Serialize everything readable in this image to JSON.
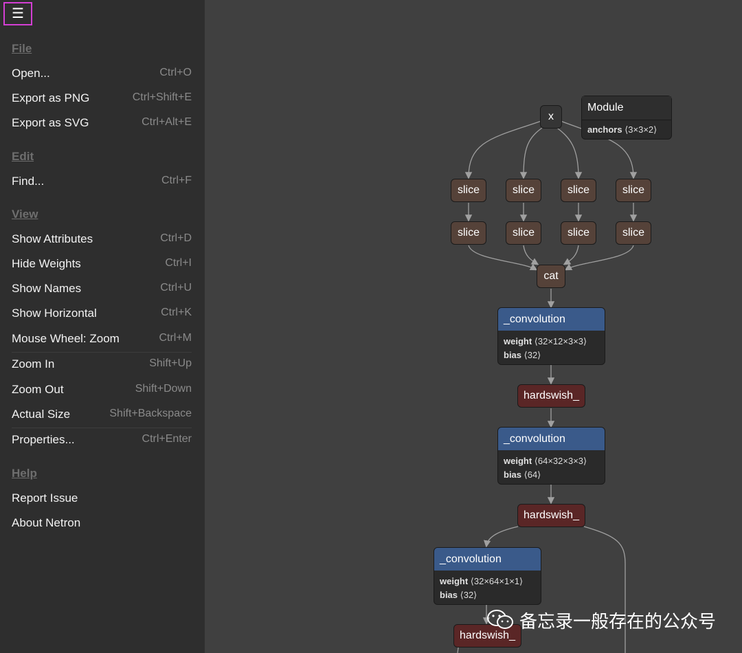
{
  "menu_button": {
    "glyph": "☰"
  },
  "menu": {
    "file": {
      "title": "File",
      "items": [
        {
          "label": "Open...",
          "shortcut": "Ctrl+O"
        },
        {
          "label": "Export as PNG",
          "shortcut": "Ctrl+Shift+E"
        },
        {
          "label": "Export as SVG",
          "shortcut": "Ctrl+Alt+E"
        }
      ]
    },
    "edit": {
      "title": "Edit",
      "items": [
        {
          "label": "Find...",
          "shortcut": "Ctrl+F"
        }
      ]
    },
    "view": {
      "title": "View",
      "items": [
        {
          "label": "Show Attributes",
          "shortcut": "Ctrl+D"
        },
        {
          "label": "Hide Weights",
          "shortcut": "Ctrl+I"
        },
        {
          "label": "Show Names",
          "shortcut": "Ctrl+U"
        },
        {
          "label": "Show Horizontal",
          "shortcut": "Ctrl+K"
        },
        {
          "label": "Mouse Wheel: Zoom",
          "shortcut": "Ctrl+M"
        },
        {
          "label": "Zoom In",
          "shortcut": "Shift+Up"
        },
        {
          "label": "Zoom Out",
          "shortcut": "Shift+Down"
        },
        {
          "label": "Actual Size",
          "shortcut": "Shift+Backspace"
        },
        {
          "label": "Properties...",
          "shortcut": "Ctrl+Enter"
        }
      ]
    },
    "help": {
      "title": "Help",
      "items": [
        {
          "label": "Report Issue"
        },
        {
          "label": "About Netron"
        }
      ]
    }
  },
  "graph": {
    "input": {
      "label": "x"
    },
    "module": {
      "title": "Module",
      "attr_name": "anchors",
      "attr_value": "⟨3×3×2⟩"
    },
    "slice_label": "slice",
    "cat_label": "cat",
    "conv1": {
      "title": "_convolution",
      "weight_name": "weight",
      "weight_value": "⟨32×12×3×3⟩",
      "bias_name": "bias",
      "bias_value": "⟨32⟩"
    },
    "conv2": {
      "title": "_convolution",
      "weight_name": "weight",
      "weight_value": "⟨64×32×3×3⟩",
      "bias_name": "bias",
      "bias_value": "⟨64⟩"
    },
    "conv3": {
      "title": "_convolution",
      "weight_name": "weight",
      "weight_value": "⟨32×64×1×1⟩",
      "bias_name": "bias",
      "bias_value": "⟨32⟩"
    },
    "hardswish_label": "hardswish_"
  },
  "watermark": {
    "text": "备忘录一般存在的公众号"
  },
  "colors": {
    "sidebar_bg": "#2e2e2e",
    "canvas_bg": "#404040",
    "menu_highlight": "#d43fd4",
    "slice_node": "#554239",
    "conv_header": "#3a5a8a",
    "hardswish_node": "#5a2626"
  }
}
